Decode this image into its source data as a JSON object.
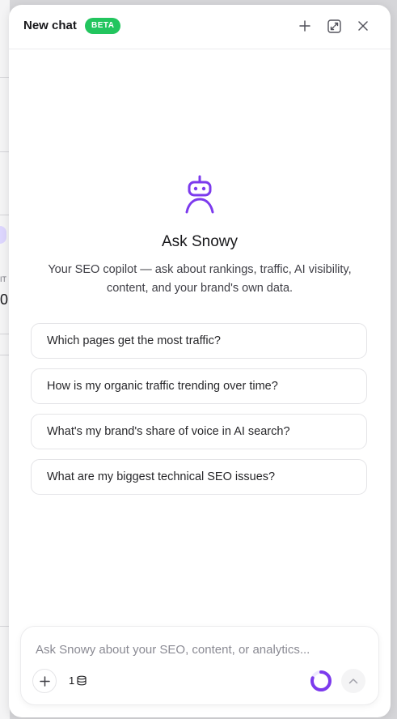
{
  "header": {
    "title": "New chat",
    "badge": "BETA",
    "new_chat_icon": "plus-icon",
    "expand_icon": "expand-icon",
    "close_icon": "close-icon"
  },
  "background": {
    "partial_label": "IT",
    "partial_value": "0"
  },
  "hero": {
    "icon": "robot-icon",
    "title": "Ask Snowy",
    "subtitle_line1": "Your SEO copilot — ask about rankings, traffic, AI visibility,",
    "subtitle_line2": "content, and your brand's own data."
  },
  "suggestions": [
    "Which pages get the most traffic?",
    "How is my organic traffic trending over time?",
    "What's my brand's share of voice in AI search?",
    "What are my biggest technical SEO issues?"
  ],
  "composer": {
    "placeholder": "Ask Snowy about your SEO, content, or analytics...",
    "value": "",
    "credits": "1",
    "credits_icon": "coins-icon",
    "usage_fraction": 0.8,
    "attach_icon": "plus-icon",
    "send_icon": "arrow-up-icon"
  },
  "colors": {
    "accent": "#7c3aed",
    "badge": "#22c55e"
  }
}
